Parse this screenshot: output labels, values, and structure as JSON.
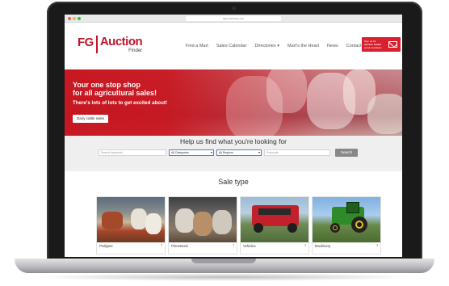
{
  "browser": {
    "url": "fgauctionfinder.com"
  },
  "header": {
    "logo": {
      "fg": "FG",
      "auction": "Auction",
      "finder": "Finder"
    },
    "nav": [
      "Find a Mart",
      "Sales Calendar",
      "Directories",
      "Mart's the Heart",
      "News",
      "Contact"
    ],
    "signup": {
      "line1": "Sign up for",
      "line2": "Auction Finder",
      "line3": "email newsletter",
      "icon": "mail-icon"
    }
  },
  "hero": {
    "title_line1": "Your one stop shop",
    "title_line2": "for all agricultural sales!",
    "subtitle": "There's lots of lots to get excited about!",
    "button_label": "Dairy cattle sales"
  },
  "search": {
    "title": "Help us find what you're looking for",
    "keywords_placeholder": "Search keywords",
    "category_selected": "All Categories",
    "region_selected": "All Regions",
    "postcode_placeholder": "Postcode",
    "button_label": "Search"
  },
  "sale_type": {
    "title": "Sale type",
    "cards": [
      {
        "label": "Pedigree"
      },
      {
        "label": "Primestock"
      },
      {
        "label": "Vehicles"
      },
      {
        "label": "Machinery"
      }
    ]
  },
  "colors": {
    "brand_red": "#c0152a",
    "accent_red": "#d8202f"
  }
}
